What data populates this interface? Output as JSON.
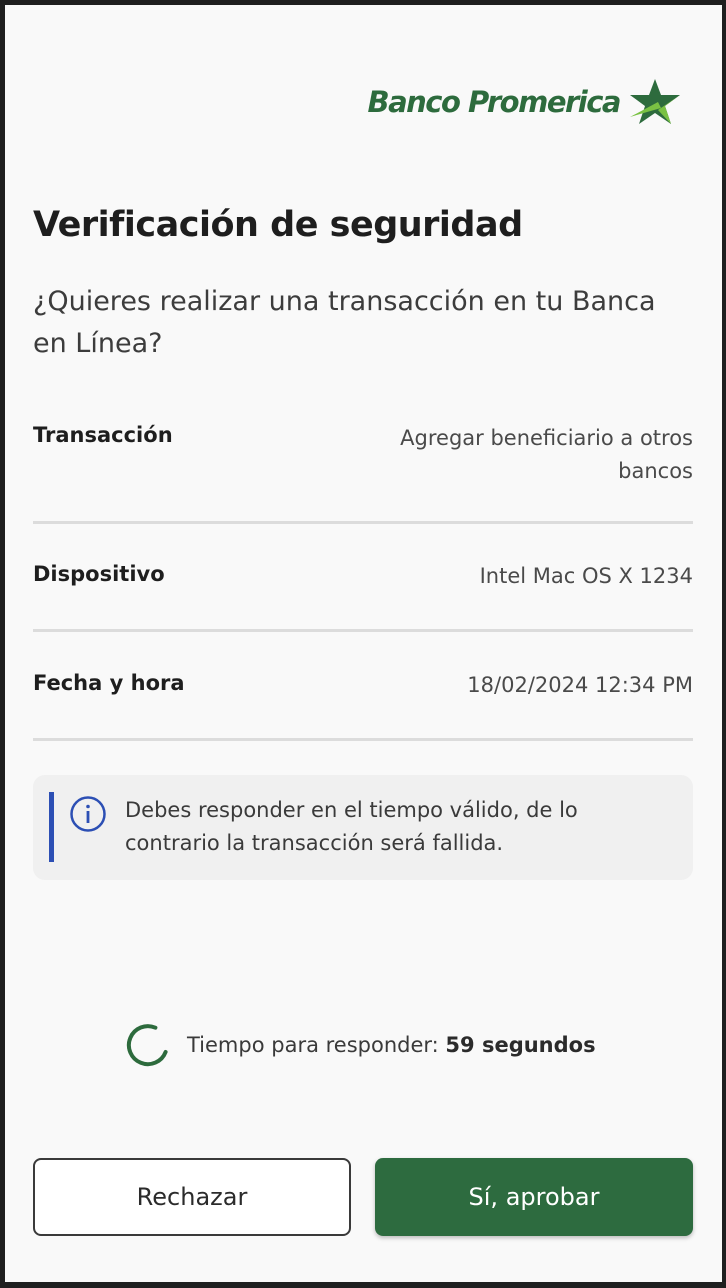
{
  "brand": {
    "name": "Banco Promerica",
    "icon": "star-logo-icon",
    "color": "#2d6b3d"
  },
  "header": {
    "title": "Verificación de seguridad",
    "question": "¿Quieres realizar una transacción en tu Banca en Línea?"
  },
  "details": [
    {
      "label": "Transacción",
      "value": "Agregar beneficiario a otros bancos"
    },
    {
      "label": "Dispositivo",
      "value": "Intel Mac OS X 1234"
    },
    {
      "label": "Fecha y hora",
      "value": "18/02/2024 12:34 PM"
    }
  ],
  "notice": {
    "icon": "info-icon",
    "text": "Debes responder en el tiempo válido, de lo contrario la transacción será fallida.",
    "accent": "#2c4fb4"
  },
  "timer": {
    "label": "Tiempo para responder:",
    "value": "59 segundos",
    "icon": "spinner-icon"
  },
  "actions": {
    "reject_label": "Rechazar",
    "approve_label": "Sí, aprobar",
    "approve_color": "#2d6b3f"
  }
}
